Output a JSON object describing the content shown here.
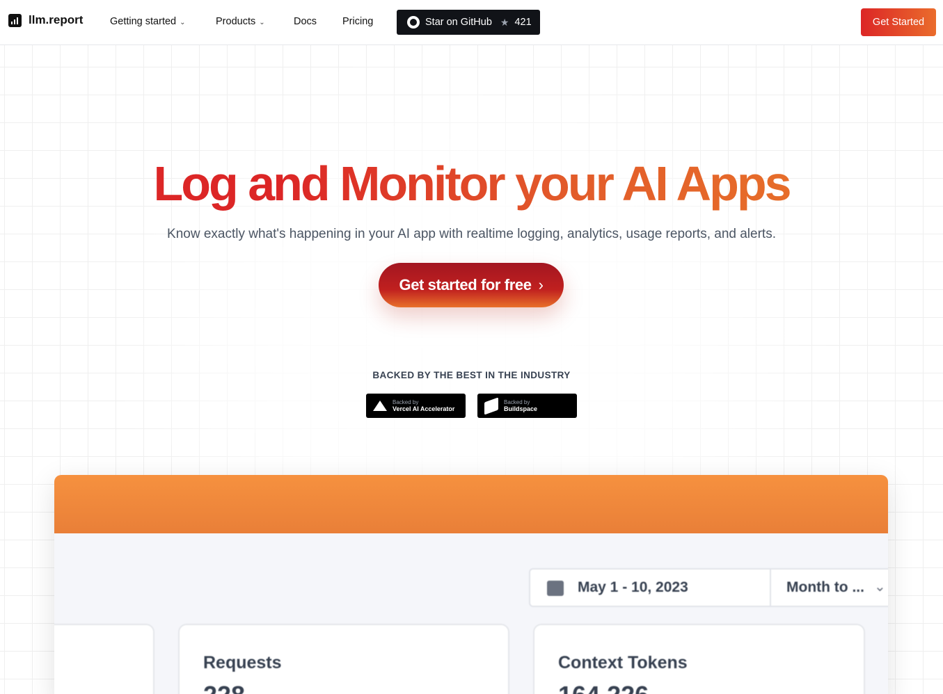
{
  "nav": {
    "logo_text": "llm.report",
    "links": [
      {
        "label": "Getting started",
        "has_menu": true
      },
      {
        "label": "Products",
        "has_menu": true
      },
      {
        "label": "Docs",
        "has_menu": false
      },
      {
        "label": "Pricing",
        "has_menu": false
      }
    ],
    "github": {
      "label": "Star on GitHub",
      "icon": "github-icon",
      "star_icon": "star-icon",
      "count": "421"
    },
    "cta": "Get Started"
  },
  "hero": {
    "title": "Log and Monitor your AI Apps",
    "subtitle": "Know exactly what's happening in your AI app with realtime logging, analytics, usage reports, and alerts.",
    "cta": "Get started for free",
    "cta_icon": "chevron-right-icon"
  },
  "backed": {
    "label": "BACKED BY THE BEST IN THE INDUSTRY",
    "badges": [
      {
        "small": "Backed by",
        "name": "Vercel AI Accelerator",
        "icon": "vercel-triangle-icon"
      },
      {
        "small": "Backed by",
        "name": "Buildspace",
        "icon": "buildspace-icon"
      }
    ]
  },
  "dashboard": {
    "date_range": "May 1 - 10, 2023",
    "period": "Month to ...",
    "cards": [
      {
        "title": "Requests",
        "value": "228"
      },
      {
        "title": "Context Tokens",
        "value": "164,226"
      }
    ]
  },
  "colors": {
    "brand_red": "#dc2626",
    "brand_orange": "#ea7a2a",
    "dark": "#111318"
  }
}
